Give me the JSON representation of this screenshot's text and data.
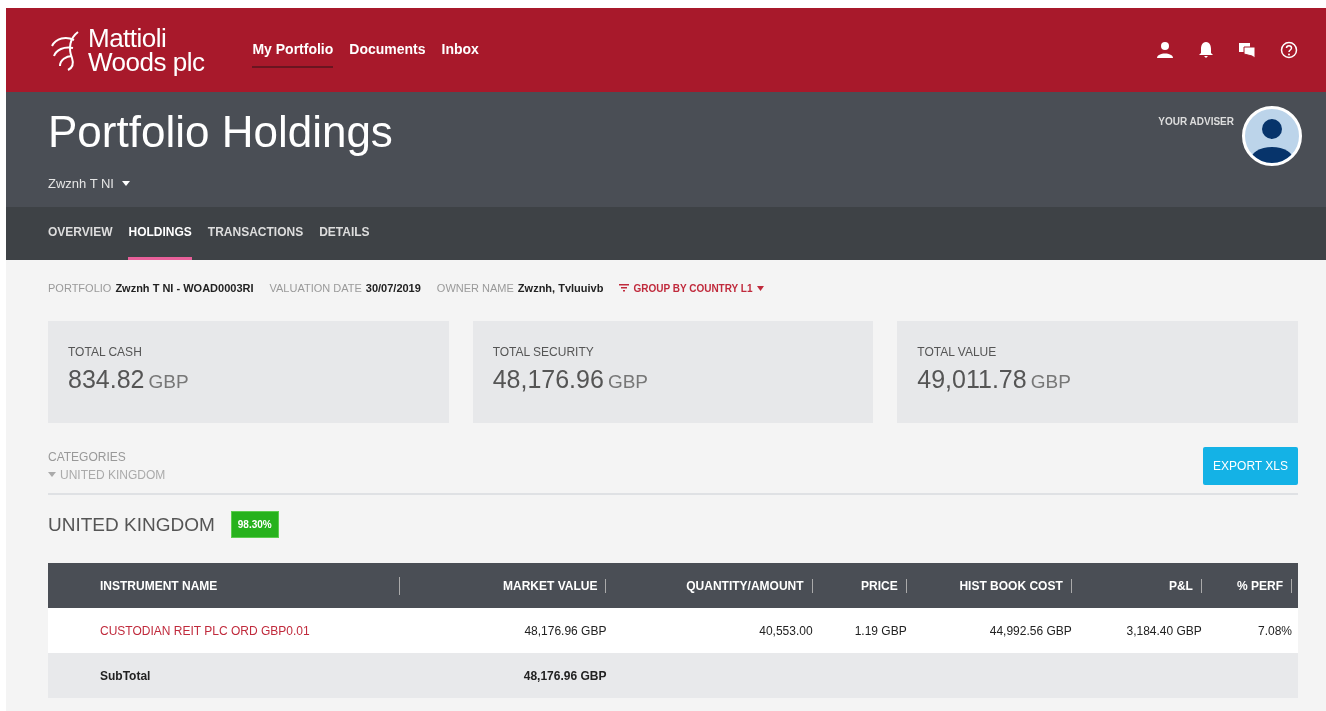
{
  "brand": {
    "line1": "Mattioli",
    "line2": "Woods plc"
  },
  "nav": [
    {
      "label": "My Portfolio",
      "selected": true
    },
    {
      "label": "Documents",
      "selected": false
    },
    {
      "label": "Inbox",
      "selected": false
    }
  ],
  "header": {
    "title": "Portfolio Holdings",
    "portfolio_selector": "Zwznh T NI",
    "adviser_label": "YOUR ADVISER"
  },
  "tabs": [
    {
      "label": "OVERVIEW",
      "selected": false
    },
    {
      "label": "HOLDINGS",
      "selected": true
    },
    {
      "label": "TRANSACTIONS",
      "selected": false
    },
    {
      "label": "DETAILS",
      "selected": false
    }
  ],
  "info": [
    {
      "label": "PORTFOLIO",
      "value": "Zwznh T NI - WOAD0003RI"
    },
    {
      "label": "VALUATION DATE",
      "value": "30/07/2019"
    },
    {
      "label": "OWNER NAME",
      "value": "Zwznh, Tvluuivb"
    }
  ],
  "group_by": "GROUP BY COUNTRY L1",
  "totals": [
    {
      "label": "TOTAL CASH",
      "amount": "834.82",
      "currency": "GBP"
    },
    {
      "label": "TOTAL SECURITY",
      "amount": "48,176.96",
      "currency": "GBP"
    },
    {
      "label": "TOTAL VALUE",
      "amount": "49,011.78",
      "currency": "GBP"
    }
  ],
  "categories": {
    "label": "CATEGORIES",
    "path": "UNITED KINGDOM"
  },
  "export_button": "EXPORT XLS",
  "section": {
    "title": "UNITED KINGDOM",
    "share": "98.30%"
  },
  "table": {
    "columns": [
      "INSTRUMENT NAME",
      "MARKET VALUE",
      "QUANTITY/AMOUNT",
      "PRICE",
      "HIST BOOK COST",
      "P&L",
      "% PERF"
    ],
    "rows": [
      {
        "kind": "holding",
        "cells": [
          "CUSTODIAN REIT PLC ORD GBP0.01",
          "48,176.96 GBP",
          "40,553.00",
          "1.19 GBP",
          "44,992.56 GBP",
          "3,184.40 GBP",
          "7.08%"
        ]
      },
      {
        "kind": "subtotal",
        "cells": [
          "SubTotal",
          "48,176.96 GBP"
        ]
      }
    ]
  }
}
